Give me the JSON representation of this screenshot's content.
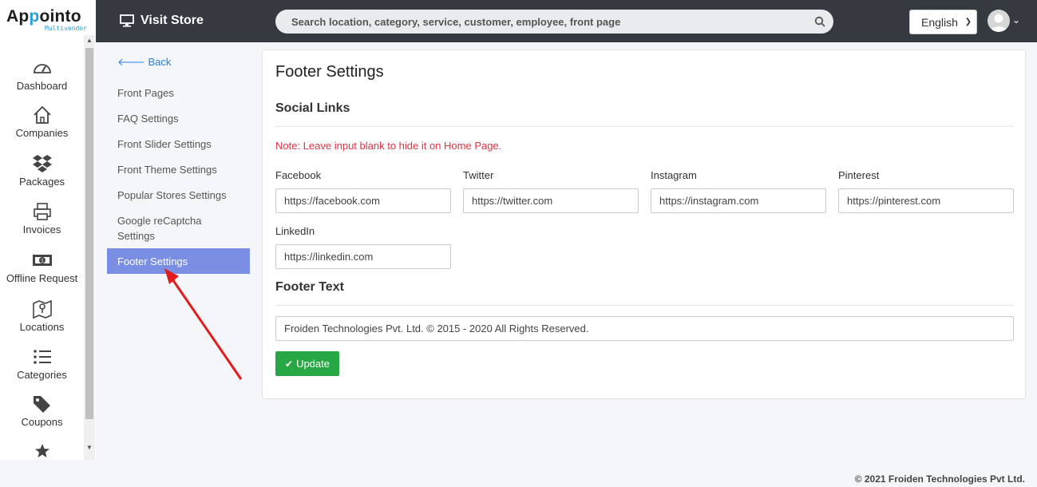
{
  "brand": {
    "name_prefix": "Ap",
    "name_highlight": "p",
    "name_suffix": "ointo",
    "sub": "Multivendor"
  },
  "topbar": {
    "visit_store": "Visit Store",
    "search_placeholder": "Search location, category, service, customer, employee, front page",
    "language": "English",
    "icons": {
      "store": "monitor-icon",
      "search": "search-icon",
      "user": "user-avatar-icon",
      "chevron": "chevron-down-icon"
    }
  },
  "sidebar": {
    "items": [
      {
        "label": "Dashboard",
        "icon": "tachometer-icon"
      },
      {
        "label": "Companies",
        "icon": "home-icon"
      },
      {
        "label": "Packages",
        "icon": "dropbox-icon"
      },
      {
        "label": "Invoices",
        "icon": "printer-icon"
      },
      {
        "label": "Offline Request",
        "icon": "money-bill-icon"
      },
      {
        "label": "Locations",
        "icon": "map-icon"
      },
      {
        "label": "Categories",
        "icon": "list-icon"
      },
      {
        "label": "Coupons",
        "icon": "tags-icon"
      },
      {
        "label": "",
        "icon": "star-icon"
      }
    ]
  },
  "settings_menu": {
    "back": "Back",
    "items": [
      "Front Pages",
      "FAQ Settings",
      "Front Slider Settings",
      "Front Theme Settings",
      "Popular Stores Settings",
      "Google reCaptcha Settings"
    ],
    "active": "Footer Settings"
  },
  "main": {
    "title": "Footer Settings",
    "social_heading": "Social Links",
    "note": "Note: Leave input blank to hide it on Home Page.",
    "fields": {
      "facebook": {
        "label": "Facebook",
        "value": "https://facebook.com"
      },
      "twitter": {
        "label": "Twitter",
        "value": "https://twitter.com"
      },
      "instagram": {
        "label": "Instagram",
        "value": "https://instagram.com"
      },
      "pinterest": {
        "label": "Pinterest",
        "value": "https://pinterest.com"
      },
      "linkedin": {
        "label": "LinkedIn",
        "value": "https://linkedin.com"
      }
    },
    "footer_text_heading": "Footer Text",
    "footer_text_value": "Froiden Technologies Pvt. Ltd. © 2015 - 2020 All Rights Reserved.",
    "update_button": "Update"
  },
  "page_footer": "© 2021 Froiden Technologies Pvt Ltd.",
  "colors": {
    "topbar": "#343a40",
    "active_menu": "#7a8ee3",
    "update_button": "#28a745",
    "note": "#dc3545",
    "link": "#2a7ee0"
  }
}
